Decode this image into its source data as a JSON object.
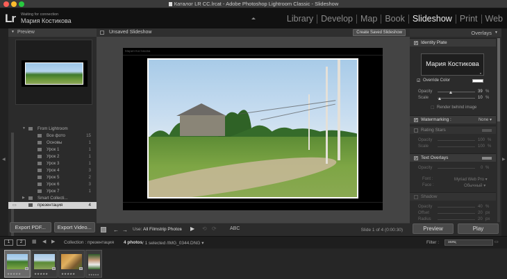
{
  "window": {
    "title": "Каталог LR CC.lrcat - Adobe Photoshop Lightroom Classic - Slideshow"
  },
  "identity": {
    "logo": "Lr",
    "status": "Waiting for connection",
    "user": "Мария Костикова"
  },
  "modules": [
    "Library",
    "Develop",
    "Map",
    "Book",
    "Slideshow",
    "Print",
    "Web"
  ],
  "active_module": "Slideshow",
  "left_panel": {
    "preview_header": "Preview",
    "collections": [
      {
        "label": "From Lightroom",
        "count": ""
      },
      {
        "label": "Все фото",
        "count": "15"
      },
      {
        "label": "Основы",
        "count": "1"
      },
      {
        "label": "Урок 1",
        "count": "1"
      },
      {
        "label": "Урок 2",
        "count": "1"
      },
      {
        "label": "Урок 3",
        "count": "1"
      },
      {
        "label": "Урок 4",
        "count": "3"
      },
      {
        "label": "Урок 5",
        "count": "2"
      },
      {
        "label": "Урок 6",
        "count": "3"
      },
      {
        "label": "Урок 7",
        "count": "1"
      },
      {
        "label": "Smart Collecti...",
        "count": ""
      },
      {
        "label": "презентация",
        "count": "4"
      }
    ],
    "export_pdf": "Export PDF...",
    "export_video": "Export Video..."
  },
  "center": {
    "slideshow_name": "Unsaved Slideshow",
    "create_saved": "Create Saved Slideshow",
    "stage_identity": "Мария Костикова",
    "toolbar": {
      "use_label": "Use:",
      "use_value": "All Filmstrip Photos",
      "abc": "ABC",
      "slide_of": "Slide 1 of 4 (0:00:30)"
    }
  },
  "right_panel": {
    "header": "Overlays",
    "identity_plate": "Identity Plate",
    "plate_text": "Мария Костикова",
    "override_color": "Override Color",
    "opacity_label": "Opacity",
    "opacity_value": "39",
    "scale_label": "Scale",
    "scale_value": "10",
    "render_behind": "Render behind image",
    "watermarking": "Watermarking :",
    "watermark_value": "None",
    "rating_stars": "Rating Stars",
    "rs_opacity": "100",
    "rs_scale": "100",
    "text_overlays": "Text Overlays",
    "to_opacity": "0",
    "font_label": "Font :",
    "font_value": "Myriad Web Pro",
    "face_label": "Face :",
    "face_value": "Обычный",
    "shadow": "Shadow",
    "sh_opacity": "40",
    "offset_label": "Offset",
    "sh_offset": "20",
    "radius_label": "Radius",
    "sh_radius": "20",
    "percent": "%",
    "px": "px",
    "preview_btn": "Preview",
    "play_btn": "Play"
  },
  "filmstrip": {
    "page1": "1",
    "page2": "2",
    "collection": "Collection : презентация",
    "photos_bold": "4 photos",
    "photos_rest": " / 1 selected /IMG_0344.DNG ▾",
    "filter_label": "Filter :",
    "filter_value": "заяц",
    "thumb_stars": "★★★★★"
  }
}
